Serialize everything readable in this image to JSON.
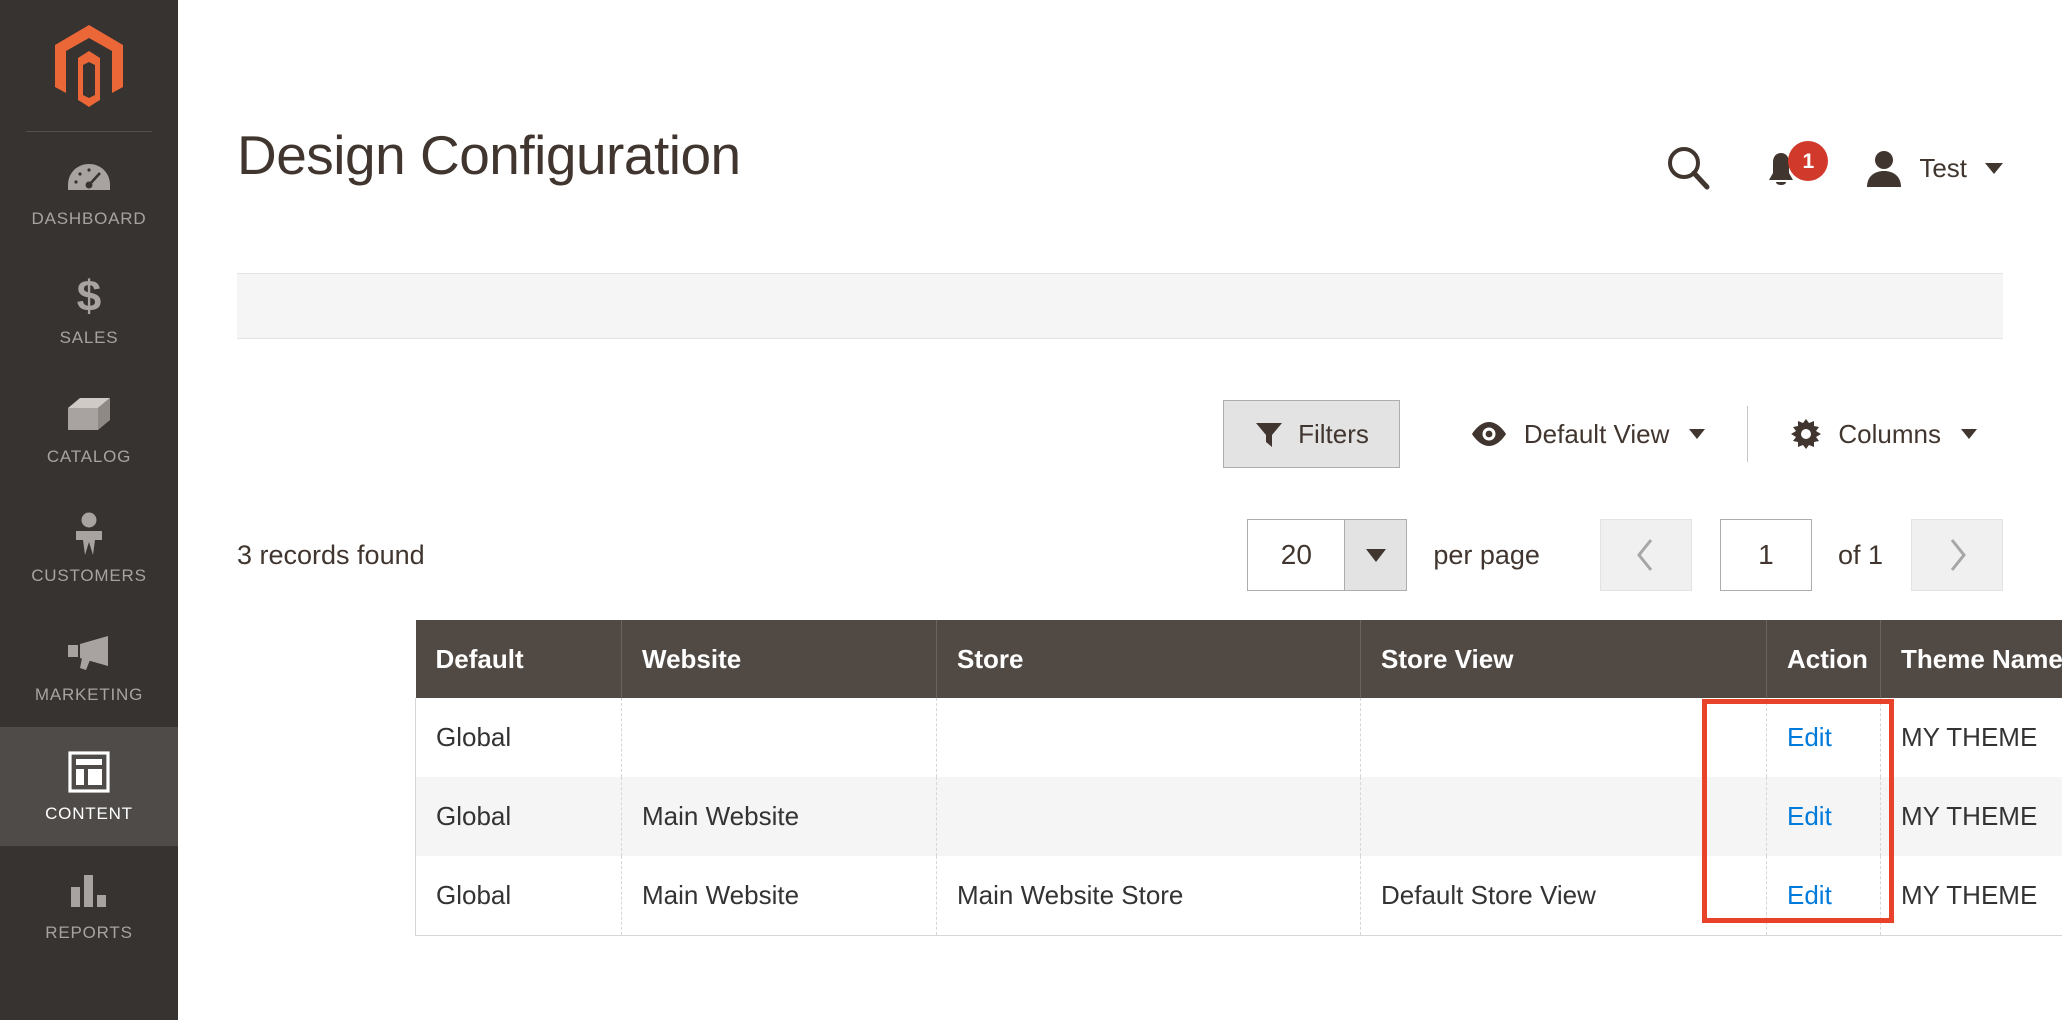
{
  "sidebar": {
    "logo": "magento-logo",
    "items": [
      {
        "label": "DASHBOARD",
        "icon": "dashboard-icon",
        "active": false
      },
      {
        "label": "SALES",
        "icon": "dollar-icon",
        "active": false
      },
      {
        "label": "CATALOG",
        "icon": "box-icon",
        "active": false
      },
      {
        "label": "CUSTOMERS",
        "icon": "person-icon",
        "active": false
      },
      {
        "label": "MARKETING",
        "icon": "megaphone-icon",
        "active": false
      },
      {
        "label": "CONTENT",
        "icon": "layout-icon",
        "active": true
      },
      {
        "label": "REPORTS",
        "icon": "bar-chart-icon",
        "active": false
      }
    ]
  },
  "header": {
    "title": "Design Configuration",
    "search_icon": "search-icon",
    "bell_icon": "bell-icon",
    "notification_count": "1",
    "avatar_icon": "user-avatar-icon",
    "user_name": "Test",
    "caret_icon": "chevron-down-icon"
  },
  "toolbar": {
    "filters_label": "Filters",
    "filters_icon": "funnel-icon",
    "view_label": "Default View",
    "view_icon": "eye-icon",
    "columns_label": "Columns",
    "columns_icon": "gear-icon"
  },
  "pager": {
    "records_found": "3 records found",
    "per_page_value": "20",
    "per_page_label": "per page",
    "prev_icon": "chevron-left-icon",
    "next_icon": "chevron-right-icon",
    "current_page": "1",
    "of_label": "of 1"
  },
  "grid": {
    "columns": [
      "Default",
      "Website",
      "Store",
      "Store View",
      "Action",
      "Theme Name"
    ],
    "rows": [
      {
        "default": "Global",
        "website": "",
        "store": "",
        "store_view": "",
        "action": "Edit",
        "theme_name": "MY THEME"
      },
      {
        "default": "Global",
        "website": "Main Website",
        "store": "",
        "store_view": "",
        "action": "Edit",
        "theme_name": "MY THEME"
      },
      {
        "default": "Global",
        "website": "Main Website",
        "store": "Main Website Store",
        "store_view": "Default Store View",
        "action": "Edit",
        "theme_name": "MY THEME"
      }
    ]
  },
  "highlight": {
    "color": "#e8432a",
    "target": "theme-name-column"
  },
  "colors": {
    "sidebar_bg": "#373330",
    "sidebar_active_bg": "#4f4b48",
    "brand_orange": "#ec6737",
    "table_header_bg": "#514943",
    "link_blue": "#007bdb",
    "badge_red": "#d1392b"
  }
}
